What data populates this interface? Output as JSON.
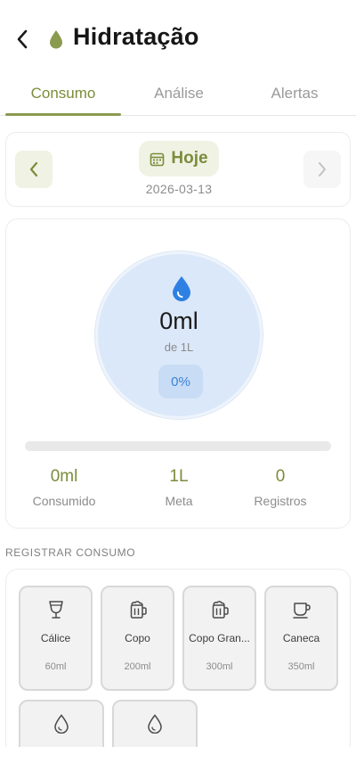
{
  "header": {
    "title": "Hidratação",
    "title_icon": "water-drop-icon",
    "back_icon": "chevron-left-icon"
  },
  "tabs": [
    {
      "label": "Consumo",
      "active": true
    },
    {
      "label": "Análise",
      "active": false
    },
    {
      "label": "Alertas",
      "active": false
    }
  ],
  "date_nav": {
    "today_label": "Hoje",
    "date": "2026-03-13",
    "calendar_icon": "calendar-icon"
  },
  "progress": {
    "amount": "0ml",
    "goal_text": "de 1L",
    "percent_label": "0%",
    "fill_fraction": 0,
    "stats": [
      {
        "value": "0ml",
        "label": "Consumido"
      },
      {
        "value": "1L",
        "label": "Meta"
      },
      {
        "value": "0",
        "label": "Registros"
      }
    ]
  },
  "register": {
    "section_label": "REGISTRAR CONSUMO",
    "options": [
      {
        "name": "Cálice",
        "volume": "60ml",
        "icon": "wine-glass-icon"
      },
      {
        "name": "Copo",
        "volume": "200ml",
        "icon": "beer-mug-icon"
      },
      {
        "name": "Copo Gran...",
        "volume": "300ml",
        "icon": "beer-mug-icon"
      },
      {
        "name": "Caneca",
        "volume": "350ml",
        "icon": "coffee-cup-icon"
      },
      {
        "name": "",
        "volume": "",
        "icon": "water-drop-icon"
      },
      {
        "name": "",
        "volume": "",
        "icon": "water-drop-icon"
      }
    ]
  },
  "colors": {
    "accent": "#7b8c3b",
    "accent_bg": "#f0f2e4",
    "water": "#3c84d8",
    "water_bg": "#dbe8f9"
  }
}
